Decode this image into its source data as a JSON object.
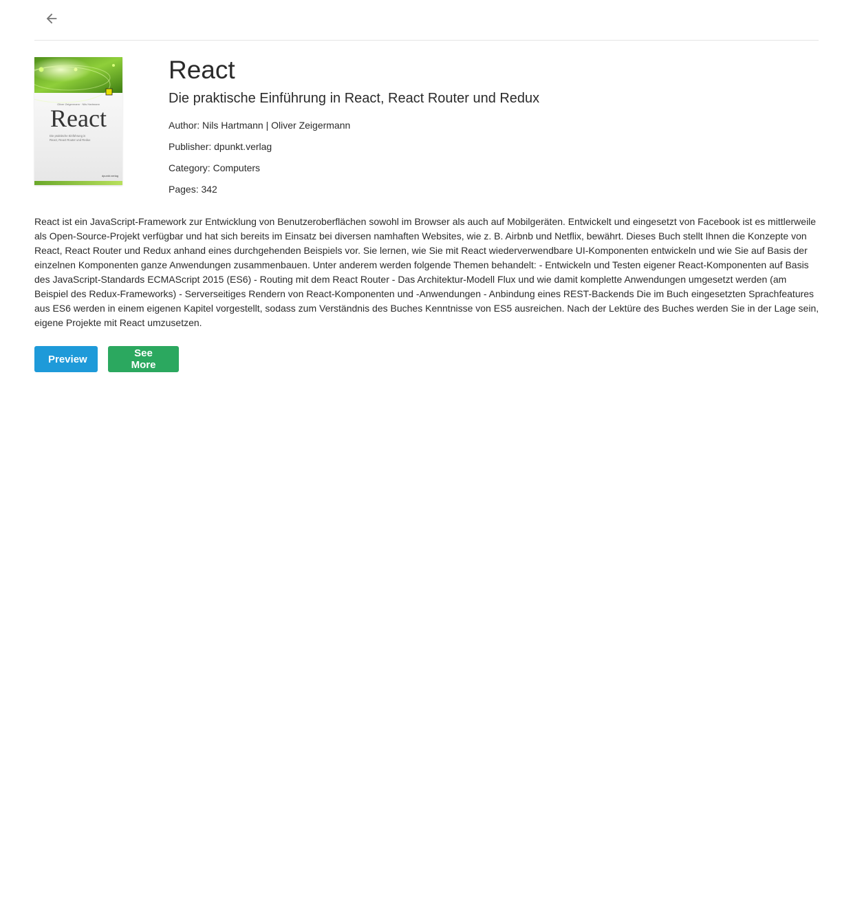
{
  "header": {
    "back_icon": "arrow-left-icon"
  },
  "book": {
    "cover": {
      "authors_line": "Oliver Zeigermann · Nils Hartmann",
      "title": "React",
      "subtitle_line1": "Die praktische Einführung in",
      "subtitle_line2": "React, React Router und Redux",
      "publisher_mark": "dpunkt.verlag"
    },
    "title": "React",
    "subtitle": "Die praktische Einführung in React, React Router und Redux",
    "author": "Author: Nils Hartmann | Oliver Zeigermann",
    "publisher": "Publisher: dpunkt.verlag",
    "category": "Category: Computers",
    "pages": "Pages: 342",
    "description": "React ist ein JavaScript-Framework zur Entwicklung von Benutzeroberflächen sowohl im Browser als auch auf Mobilgeräten. Entwickelt und eingesetzt von Facebook ist es mittlerweile als Open-Source-Projekt verfügbar und hat sich bereits im Einsatz bei diversen namhaften Websites, wie z. B. Airbnb und Netflix, bewährt. Dieses Buch stellt Ihnen die Konzepte von React, React Router und Redux anhand eines durchgehenden Beispiels vor. Sie lernen, wie Sie mit React wiederverwendbare UI-Komponenten entwickeln und wie Sie auf Basis der einzelnen Komponenten ganze Anwendungen zusammenbauen. Unter anderem werden folgende Themen behandelt: - Entwickeln und Testen eigener React-Komponenten auf Basis des JavaScript-Standards ECMAScript 2015 (ES6) - Routing mit dem React Router - Das Architektur-Modell Flux und wie damit komplette Anwendungen umgesetzt werden (am Beispiel des Redux-Frameworks) - Serverseitiges Rendern von React-Komponenten und -Anwendungen - Anbindung eines REST-Backends Die im Buch eingesetzten Sprachfeatures aus ES6 werden in einem eigenen Kapitel vorgestellt, sodass zum Verständnis des Buches Kenntnisse von ES5 ausreichen. Nach der Lektüre des Buches werden Sie in der Lage sein, eigene Projekte mit React umzusetzen."
  },
  "actions": {
    "preview_label": "Preview",
    "see_more_label": "See More"
  },
  "colors": {
    "preview_button": "#1e9ad9",
    "see_more_button": "#2ba85f",
    "cover_green": "#7cb83a"
  }
}
